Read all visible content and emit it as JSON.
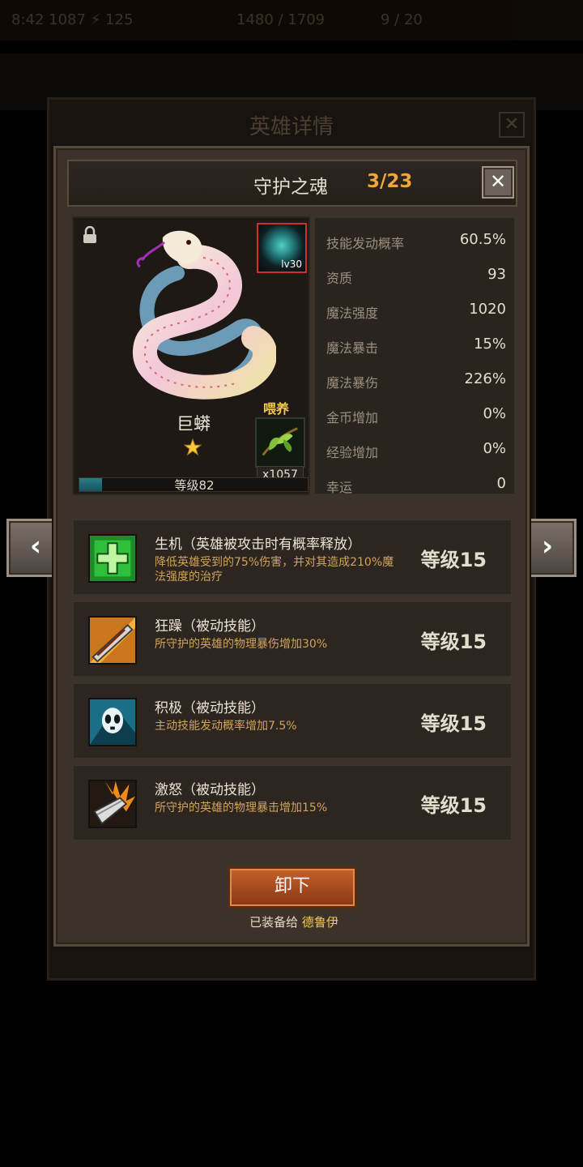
{
  "background": {
    "status_left": "8:42 1087 ⚡ 125",
    "status_mid": "1480 / 1709",
    "status_right": "9 / 20",
    "title": "英雄详情",
    "close": "✕"
  },
  "dialog": {
    "title": "守护之魂",
    "count": "3/23",
    "close": "✕"
  },
  "hero": {
    "name": "巨蟒",
    "stars": 1,
    "skill_badge_level": "lv30",
    "feed_label": "喂养",
    "feed_count": "x1057",
    "level_text": "等级82",
    "level_progress": 0.1
  },
  "stats": [
    {
      "label": "技能发动概率",
      "value": "60.5%"
    },
    {
      "label": "资质",
      "value": "93"
    },
    {
      "label": "魔法强度",
      "value": "1020"
    },
    {
      "label": "魔法暴击",
      "value": "15%"
    },
    {
      "label": "魔法暴伤",
      "value": "226%"
    },
    {
      "label": "金币增加",
      "value": "0%"
    },
    {
      "label": "经验增加",
      "value": "0%"
    },
    {
      "label": "幸运",
      "value": "0"
    }
  ],
  "skills": [
    {
      "icon": "heal-cross-icon",
      "name": "生机（英雄被攻击时有概率释放）",
      "desc": "降低英雄受到的75%伤害，并对其造成210%魔法强度的治疗",
      "level": "等级15"
    },
    {
      "icon": "sword-rage-icon",
      "name": "狂躁（被动技能）",
      "desc": "所守护的英雄的物理暴伤增加30%",
      "level": "等级15"
    },
    {
      "icon": "ghost-mask-icon",
      "name": "积极（被动技能）",
      "desc": "主动技能发动概率增加7.5%",
      "level": "等级15"
    },
    {
      "icon": "flaming-blade-icon",
      "name": "激怒（被动技能）",
      "desc": "所守护的英雄的物理暴击增加15%",
      "level": "等级15"
    }
  ],
  "unequip_label": "卸下",
  "equipped_prefix": "已装备给",
  "equipped_hero": "德鲁伊",
  "nav": {
    "prev": "‹",
    "next": "›"
  }
}
